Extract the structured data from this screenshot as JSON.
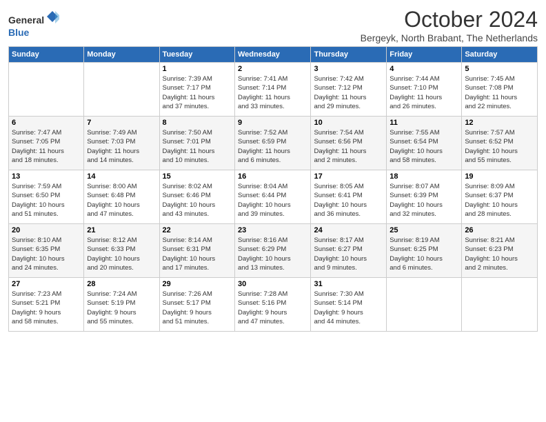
{
  "header": {
    "logo_general": "General",
    "logo_blue": "Blue",
    "title": "October 2024",
    "subtitle": "Bergeyk, North Brabant, The Netherlands"
  },
  "columns": [
    "Sunday",
    "Monday",
    "Tuesday",
    "Wednesday",
    "Thursday",
    "Friday",
    "Saturday"
  ],
  "weeks": [
    {
      "days": [
        {
          "num": "",
          "info": ""
        },
        {
          "num": "",
          "info": ""
        },
        {
          "num": "1",
          "info": "Sunrise: 7:39 AM\nSunset: 7:17 PM\nDaylight: 11 hours\nand 37 minutes."
        },
        {
          "num": "2",
          "info": "Sunrise: 7:41 AM\nSunset: 7:14 PM\nDaylight: 11 hours\nand 33 minutes."
        },
        {
          "num": "3",
          "info": "Sunrise: 7:42 AM\nSunset: 7:12 PM\nDaylight: 11 hours\nand 29 minutes."
        },
        {
          "num": "4",
          "info": "Sunrise: 7:44 AM\nSunset: 7:10 PM\nDaylight: 11 hours\nand 26 minutes."
        },
        {
          "num": "5",
          "info": "Sunrise: 7:45 AM\nSunset: 7:08 PM\nDaylight: 11 hours\nand 22 minutes."
        }
      ]
    },
    {
      "days": [
        {
          "num": "6",
          "info": "Sunrise: 7:47 AM\nSunset: 7:05 PM\nDaylight: 11 hours\nand 18 minutes."
        },
        {
          "num": "7",
          "info": "Sunrise: 7:49 AM\nSunset: 7:03 PM\nDaylight: 11 hours\nand 14 minutes."
        },
        {
          "num": "8",
          "info": "Sunrise: 7:50 AM\nSunset: 7:01 PM\nDaylight: 11 hours\nand 10 minutes."
        },
        {
          "num": "9",
          "info": "Sunrise: 7:52 AM\nSunset: 6:59 PM\nDaylight: 11 hours\nand 6 minutes."
        },
        {
          "num": "10",
          "info": "Sunrise: 7:54 AM\nSunset: 6:56 PM\nDaylight: 11 hours\nand 2 minutes."
        },
        {
          "num": "11",
          "info": "Sunrise: 7:55 AM\nSunset: 6:54 PM\nDaylight: 10 hours\nand 58 minutes."
        },
        {
          "num": "12",
          "info": "Sunrise: 7:57 AM\nSunset: 6:52 PM\nDaylight: 10 hours\nand 55 minutes."
        }
      ]
    },
    {
      "days": [
        {
          "num": "13",
          "info": "Sunrise: 7:59 AM\nSunset: 6:50 PM\nDaylight: 10 hours\nand 51 minutes."
        },
        {
          "num": "14",
          "info": "Sunrise: 8:00 AM\nSunset: 6:48 PM\nDaylight: 10 hours\nand 47 minutes."
        },
        {
          "num": "15",
          "info": "Sunrise: 8:02 AM\nSunset: 6:46 PM\nDaylight: 10 hours\nand 43 minutes."
        },
        {
          "num": "16",
          "info": "Sunrise: 8:04 AM\nSunset: 6:44 PM\nDaylight: 10 hours\nand 39 minutes."
        },
        {
          "num": "17",
          "info": "Sunrise: 8:05 AM\nSunset: 6:41 PM\nDaylight: 10 hours\nand 36 minutes."
        },
        {
          "num": "18",
          "info": "Sunrise: 8:07 AM\nSunset: 6:39 PM\nDaylight: 10 hours\nand 32 minutes."
        },
        {
          "num": "19",
          "info": "Sunrise: 8:09 AM\nSunset: 6:37 PM\nDaylight: 10 hours\nand 28 minutes."
        }
      ]
    },
    {
      "days": [
        {
          "num": "20",
          "info": "Sunrise: 8:10 AM\nSunset: 6:35 PM\nDaylight: 10 hours\nand 24 minutes."
        },
        {
          "num": "21",
          "info": "Sunrise: 8:12 AM\nSunset: 6:33 PM\nDaylight: 10 hours\nand 20 minutes."
        },
        {
          "num": "22",
          "info": "Sunrise: 8:14 AM\nSunset: 6:31 PM\nDaylight: 10 hours\nand 17 minutes."
        },
        {
          "num": "23",
          "info": "Sunrise: 8:16 AM\nSunset: 6:29 PM\nDaylight: 10 hours\nand 13 minutes."
        },
        {
          "num": "24",
          "info": "Sunrise: 8:17 AM\nSunset: 6:27 PM\nDaylight: 10 hours\nand 9 minutes."
        },
        {
          "num": "25",
          "info": "Sunrise: 8:19 AM\nSunset: 6:25 PM\nDaylight: 10 hours\nand 6 minutes."
        },
        {
          "num": "26",
          "info": "Sunrise: 8:21 AM\nSunset: 6:23 PM\nDaylight: 10 hours\nand 2 minutes."
        }
      ]
    },
    {
      "days": [
        {
          "num": "27",
          "info": "Sunrise: 7:23 AM\nSunset: 5:21 PM\nDaylight: 9 hours\nand 58 minutes."
        },
        {
          "num": "28",
          "info": "Sunrise: 7:24 AM\nSunset: 5:19 PM\nDaylight: 9 hours\nand 55 minutes."
        },
        {
          "num": "29",
          "info": "Sunrise: 7:26 AM\nSunset: 5:17 PM\nDaylight: 9 hours\nand 51 minutes."
        },
        {
          "num": "30",
          "info": "Sunrise: 7:28 AM\nSunset: 5:16 PM\nDaylight: 9 hours\nand 47 minutes."
        },
        {
          "num": "31",
          "info": "Sunrise: 7:30 AM\nSunset: 5:14 PM\nDaylight: 9 hours\nand 44 minutes."
        },
        {
          "num": "",
          "info": ""
        },
        {
          "num": "",
          "info": ""
        }
      ]
    }
  ]
}
